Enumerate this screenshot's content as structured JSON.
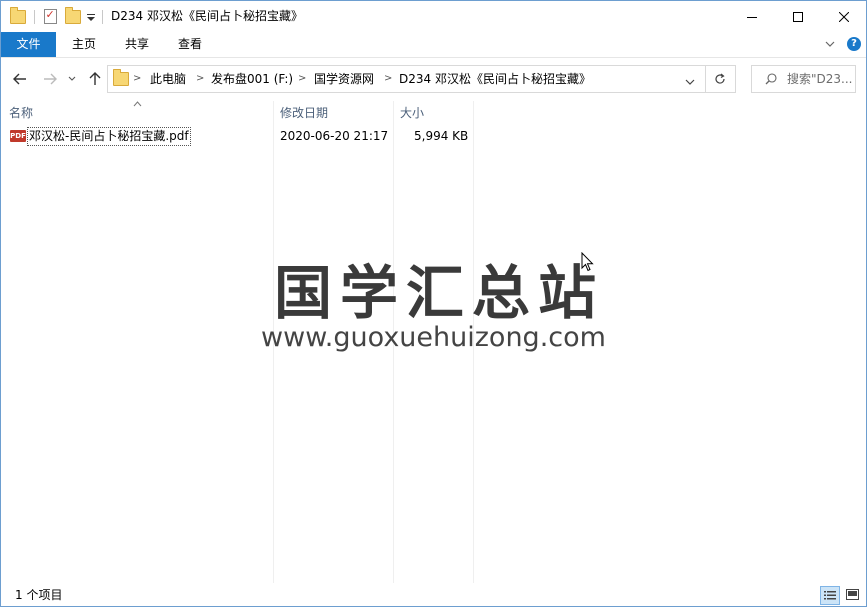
{
  "window": {
    "title": "D234 邓汉松《民间占卜秘招宝藏》",
    "controls": [
      "minimize-icon",
      "maximize-icon",
      "close-icon"
    ]
  },
  "ribbon": {
    "tabs": [
      {
        "label": "文件",
        "active": true
      },
      {
        "label": "主页"
      },
      {
        "label": "共享"
      },
      {
        "label": "查看"
      }
    ]
  },
  "address": {
    "crumbs": [
      "此电脑",
      "发布盘001 (F:)",
      "国学资源网",
      "D234 邓汉松《民间占卜秘招宝藏》"
    ]
  },
  "search": {
    "placeholder": "搜索\"D23..."
  },
  "columns": {
    "name": "名称",
    "date": "修改日期",
    "size": "大小"
  },
  "files": [
    {
      "icon": "pdf-file-icon",
      "icon_text": "PDF",
      "name": "邓汉松-民间占卜秘招宝藏.pdf",
      "date": "2020-06-20 21:17",
      "size": "5,994 KB"
    }
  ],
  "watermark": {
    "title": "国学汇总站",
    "url": "www.guoxuehuizong.com"
  },
  "status": {
    "count": "1 个项目"
  },
  "colors": {
    "accent": "#1979ca",
    "header_text": "#4c607a",
    "pdf_red": "#c0392b"
  }
}
